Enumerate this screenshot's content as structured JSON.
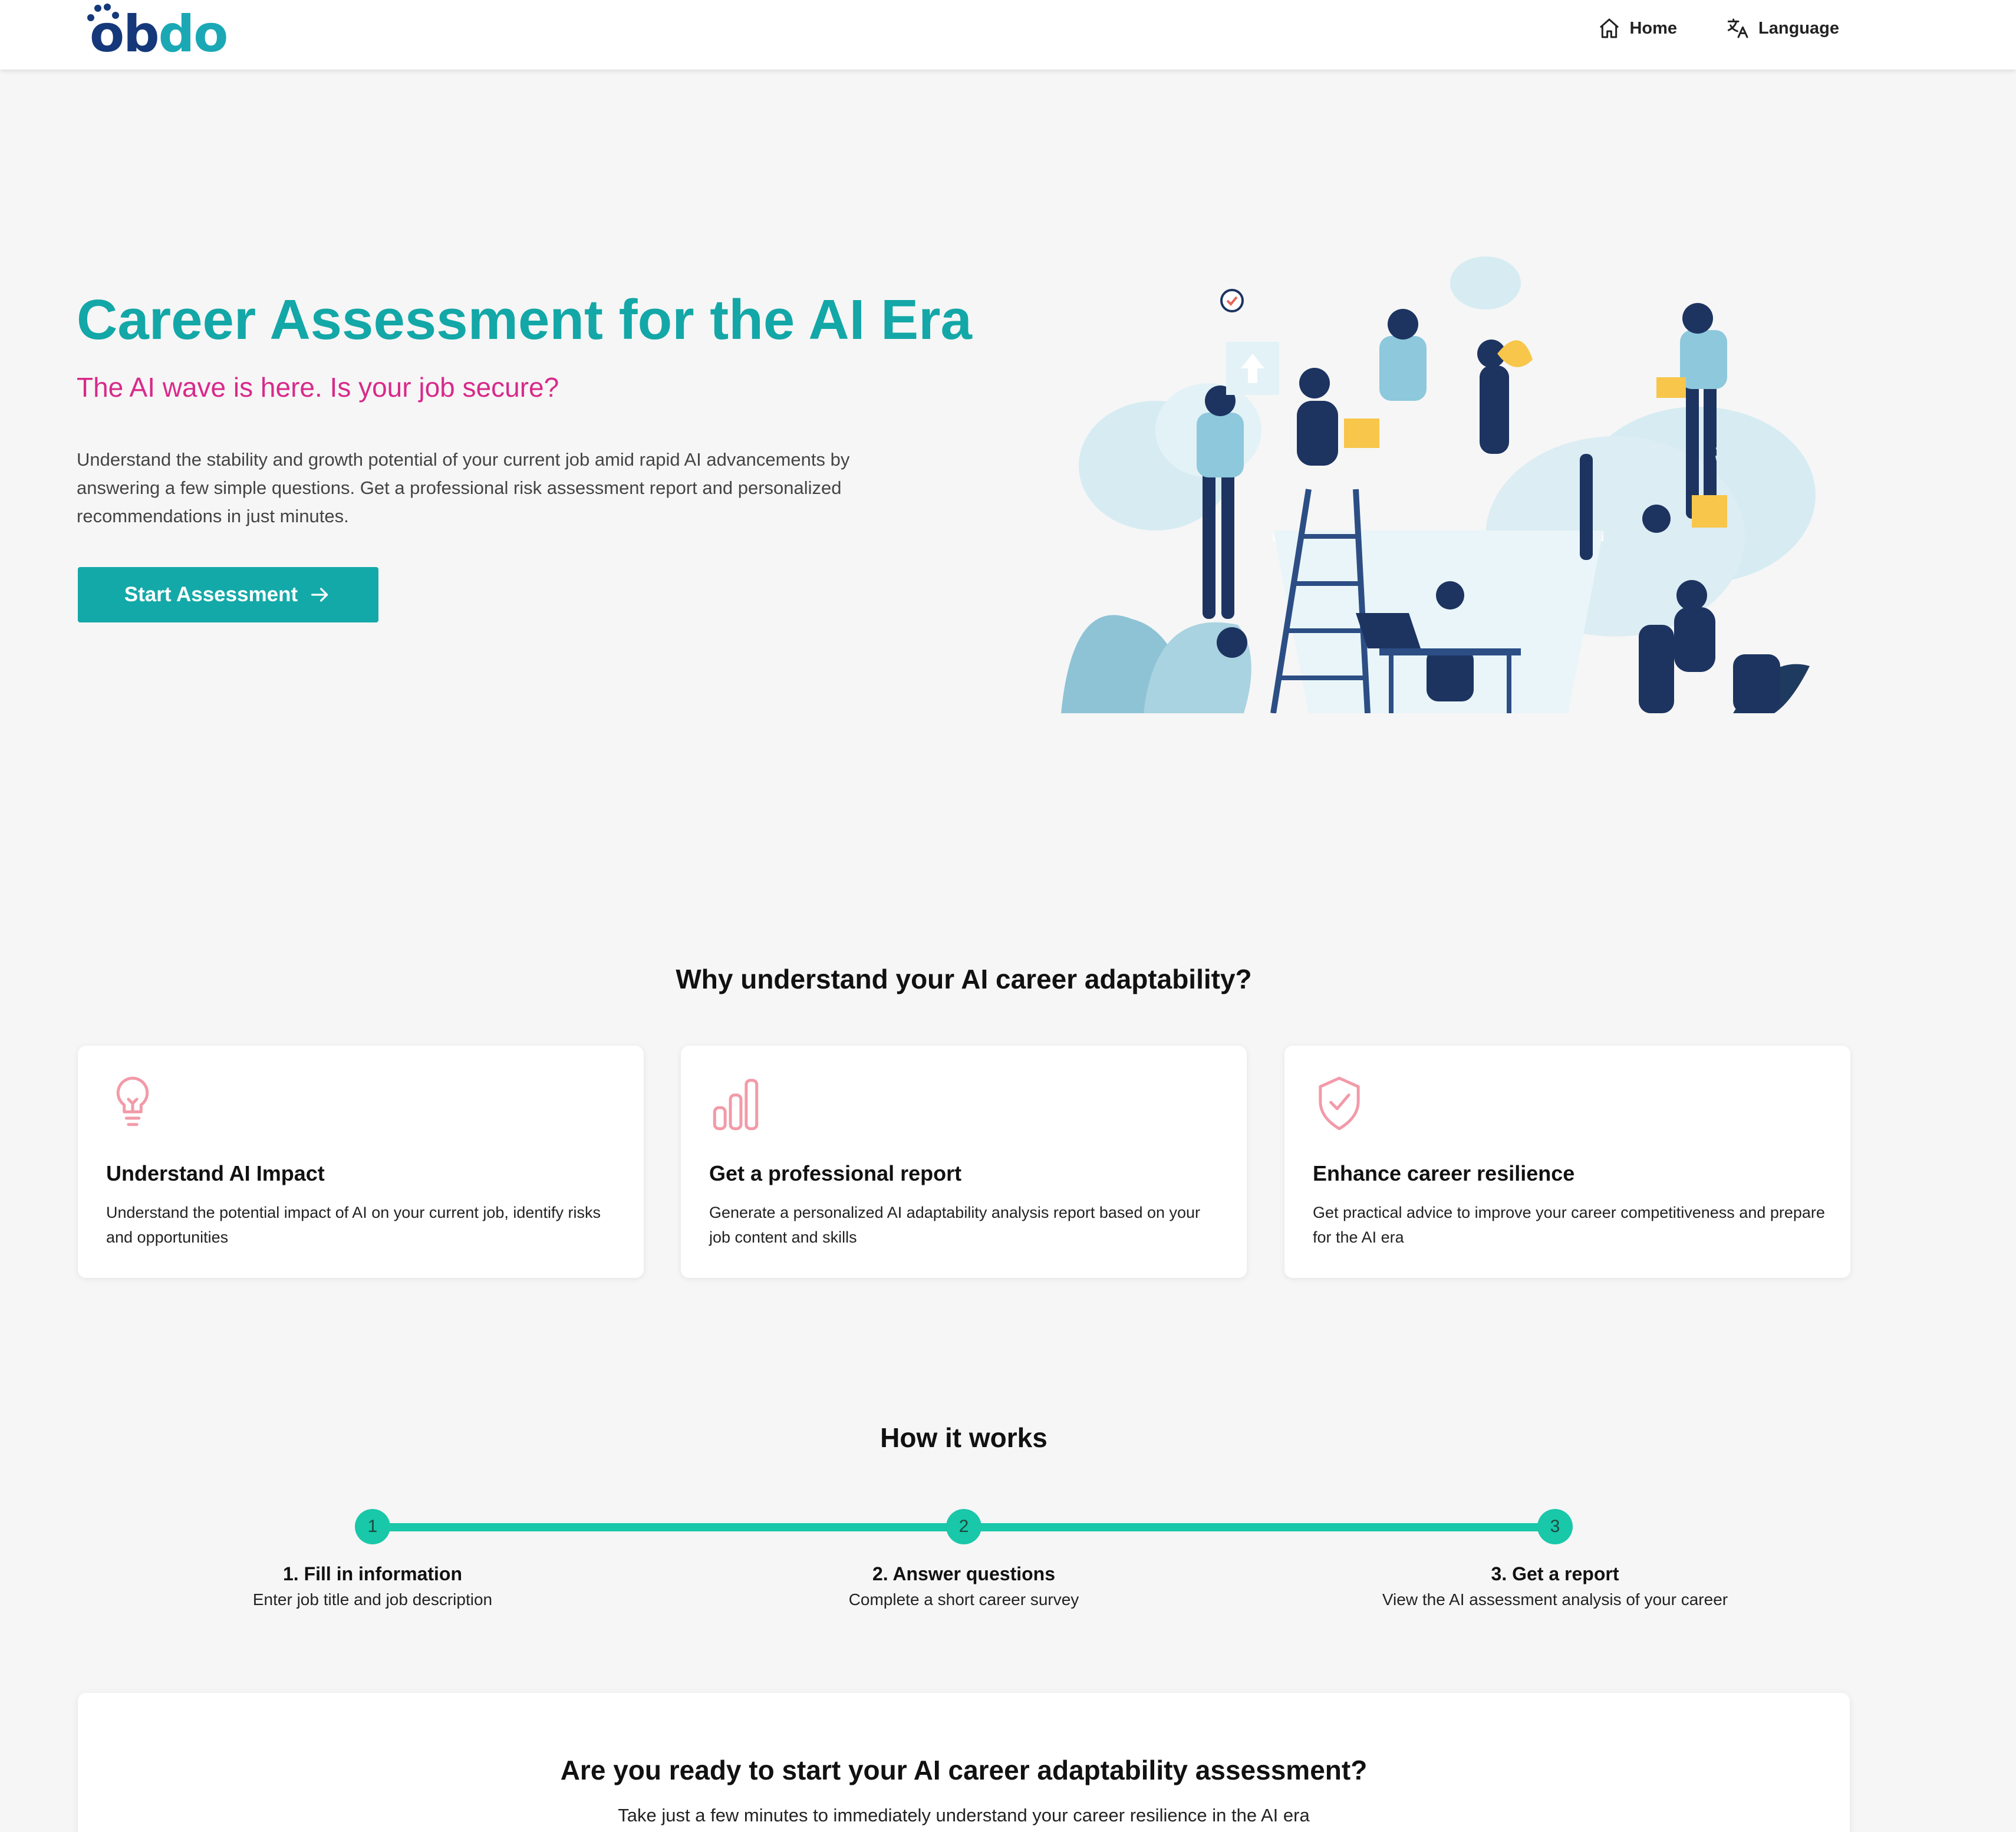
{
  "header": {
    "logo_text": {
      "o": "o",
      "b": "b",
      "do": "do"
    },
    "nav": [
      {
        "label": "Home",
        "icon": "home-icon"
      },
      {
        "label": "Language",
        "icon": "translate-icon"
      }
    ]
  },
  "hero": {
    "title": "Career Assessment for the AI Era",
    "subtitle": "The AI wave is here. Is your job secure?",
    "description": "Understand the stability and growth potential of your current job amid rapid AI advancements by answering a few simple questions. Get a professional risk assessment report and personalized recommendations in just minutes.",
    "cta_label": "Start Assessment",
    "cta_icon": "arrow-right-icon"
  },
  "why": {
    "title": "Why understand your AI career adaptability?",
    "cards": [
      {
        "icon": "lightbulb-icon",
        "title": "Understand AI Impact",
        "text": "Understand the potential impact of AI on your current job, identify risks and opportunities"
      },
      {
        "icon": "bar-chart-icon",
        "title": "Get a professional report",
        "text": "Generate a personalized AI adaptability analysis report based on your job content and skills"
      },
      {
        "icon": "shield-check-icon",
        "title": "Enhance career resilience",
        "text": "Get practical advice to improve your career competitiveness and prepare for the AI era"
      }
    ]
  },
  "how": {
    "title": "How it works",
    "steps": [
      {
        "number": "1",
        "label": "1. Fill in information",
        "desc": "Enter job title and job description"
      },
      {
        "number": "2",
        "label": "2. Answer questions",
        "desc": "Complete a short career survey"
      },
      {
        "number": "3",
        "label": "3. Get a report",
        "desc": "View the AI assessment analysis of your career"
      }
    ]
  },
  "cta_section": {
    "title": "Are you ready to start your AI career adaptability assessment?",
    "text": "Take just a few minutes to immediately understand your career resilience in the AI era"
  },
  "colors": {
    "brand_teal": "#13a7a7",
    "accent_pink": "#d82a8a",
    "step_green": "#19c7a9",
    "logo_navy": "#14387a"
  }
}
